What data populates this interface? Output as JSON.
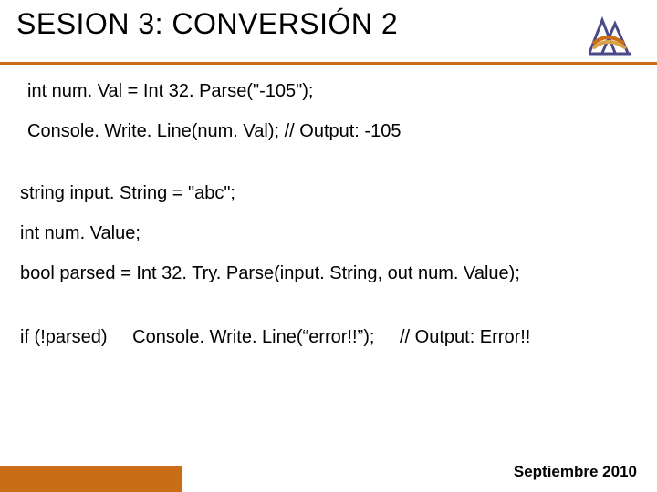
{
  "header": {
    "title": "SESION 3: CONVERSIÓN 2"
  },
  "code": {
    "l1": "int num. Val = Int 32. Parse(\"-105\");",
    "l2": "Console. Write. Line(num. Val); // Output: -105",
    "l3": "string input. String = \"abc\";",
    "l4": "int num. Value;",
    "l5": "bool parsed = Int 32. Try. Parse(input. String, out num. Value);",
    "l6a": "if (!parsed)",
    "l6b": "Console. Write. Line(“error!!”);",
    "l6c": "// Output: Error!!"
  },
  "footer": {
    "date": "Septiembre 2010"
  }
}
